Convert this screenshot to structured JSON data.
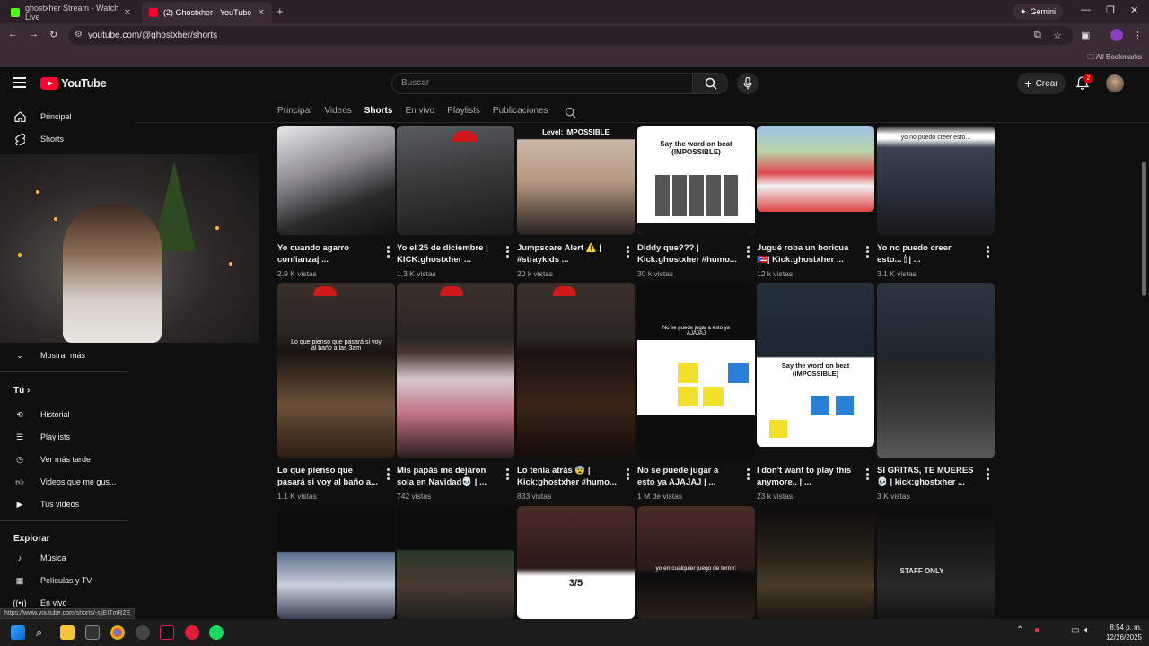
{
  "browser": {
    "tabs": [
      {
        "title": "ghostxher Stream - Watch Live",
        "color": "#53fc18",
        "active": false
      },
      {
        "title": "(2) Ghostxher - YouTube",
        "color": "#ff0033",
        "active": true
      }
    ],
    "gemini_label": "Gemini",
    "url": "youtube.com/@ghostxher/shorts",
    "all_bookmarks": "All Bookmarks",
    "status_url": "https://www.youtube.com/shorts/-sjjEITmRZE"
  },
  "youtube": {
    "logo_text": "YouTube",
    "search_placeholder": "Buscar",
    "create_label": "Crear",
    "notification_count": "2"
  },
  "sidebar": {
    "main": [
      {
        "label": "Principal",
        "icon": "home-icon"
      },
      {
        "label": "Shorts",
        "icon": "shorts-icon"
      }
    ],
    "show_more": "Mostrar más",
    "you_heading": "Tú",
    "you_items": [
      {
        "label": "Historial",
        "icon": "history-icon"
      },
      {
        "label": "Playlists",
        "icon": "playlists-icon"
      },
      {
        "label": "Ver más tarde",
        "icon": "watch-later-icon"
      },
      {
        "label": "Videos que me gus...",
        "icon": "like-icon"
      },
      {
        "label": "Tus videos",
        "icon": "your-videos-icon"
      }
    ],
    "explore_heading": "Explorar",
    "explore_items": [
      {
        "label": "Música",
        "icon": "music-icon"
      },
      {
        "label": "Películas y TV",
        "icon": "movies-icon"
      },
      {
        "label": "En vivo",
        "icon": "live-icon"
      }
    ]
  },
  "channel_tabs": [
    "Principal",
    "Videos",
    "Shorts",
    "En vivo",
    "Playlists",
    "Publicaciones"
  ],
  "active_tab": "Shorts",
  "shorts_row1": [
    {
      "title": "Yo cuando agarro confianza| ...",
      "views": "2.9 K vistas",
      "overlay": ""
    },
    {
      "title": "Yo el 25 de diciembre | KICK:ghostxher ...",
      "views": "1.3 K vistas",
      "overlay": ""
    },
    {
      "title": "Jumpscare Alert ⚠️ | #straykids ...",
      "views": "20 k vistas",
      "overlay": "Level: IMPOSSIBLE"
    },
    {
      "title": "Diddy que??? | Kick:ghostxher #humo...",
      "views": "30 k vistas",
      "overlay": "Say the word on beat (IMPOSSIBLE)"
    },
    {
      "title": "Jugué roba un boricua 🇵🇷| Kick:ghostxher ...",
      "views": "12 k vistas",
      "overlay": ""
    },
    {
      "title": "Yo no puedo creer esto... 🕯 | ...",
      "views": "3.1 K vistas",
      "overlay": "yo no puedo creer esto..."
    }
  ],
  "shorts_row2": [
    {
      "title": "Lo que pienso que pasará si voy al baño a...",
      "views": "1.1 K vistas",
      "overlay": "Lo que pienso que pasará si voy al baño a las 3am"
    },
    {
      "title": "Mis papás me dejaron sola en Navidad💀 | ...",
      "views": "742 vistas",
      "overlay": ""
    },
    {
      "title": "Lo tenía atrás 😨 | Kick:ghostxher #humo...",
      "views": "833 vistas",
      "overlay": ""
    },
    {
      "title": "No se puede jugar a esto ya AJAJAJ | ...",
      "views": "1 M de vistas",
      "overlay": "No se puede jugar a esto ya AJAJAJ"
    },
    {
      "title": "I don't want to play this anymore.. | ...",
      "views": "23 k vistas",
      "overlay": "Say the word on beat (IMPOSSIBLE)"
    },
    {
      "title": "SI GRITAS, TE MUERES 💀 | kick:ghostxher ...",
      "views": "3 K vistas",
      "overlay": ""
    }
  ],
  "shorts_row3_overlays": [
    "",
    "",
    "3/5",
    "yo en cualquier juego de terror:",
    "",
    "STAFF ONLY"
  ],
  "taskbar": {
    "time": "8:54 p. m.",
    "date": "12/26/2025"
  }
}
